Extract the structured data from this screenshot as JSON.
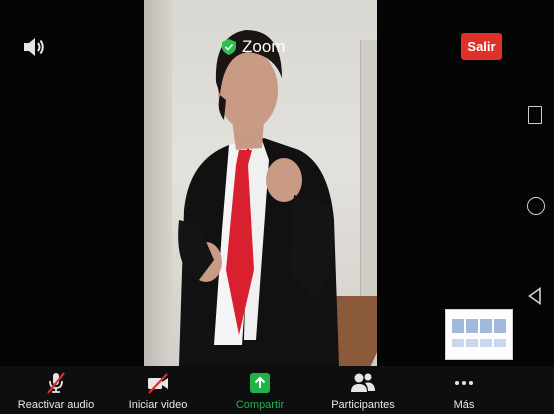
{
  "header": {
    "title": "Zoom",
    "leave_label": "Salir"
  },
  "toolbar": {
    "items": [
      {
        "label": "Reactivar audio",
        "icon": "muted-mic-icon"
      },
      {
        "label": "Iniciar video",
        "icon": "video-off-icon"
      },
      {
        "label": "Compartir",
        "icon": "share-screen-icon"
      },
      {
        "label": "Participantes",
        "icon": "participants-icon"
      },
      {
        "label": "Más",
        "icon": "more-icon"
      }
    ]
  },
  "colors": {
    "leave": "#e0302a",
    "share": "#22b24c",
    "mute_slash": "#e0302a",
    "shield": "#2fbf4f"
  },
  "android_nav": [
    "recent-apps-icon",
    "home-icon",
    "back-icon"
  ]
}
